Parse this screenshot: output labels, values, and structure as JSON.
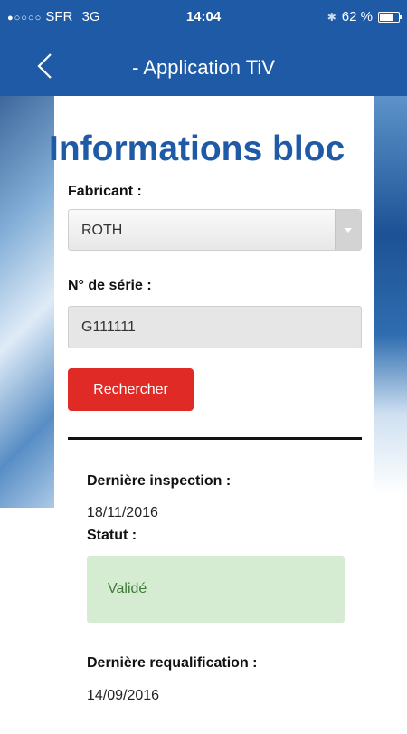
{
  "status_bar": {
    "carrier_signal": "●○○○○",
    "carrier": "SFR",
    "network": "3G",
    "time": "14:04",
    "bluetooth": "✱",
    "battery_text": "62 %",
    "battery_level": 0.62
  },
  "nav": {
    "title": "- Application TiV",
    "back_icon": "chevron-left-icon"
  },
  "form": {
    "heading": "Informations bloc",
    "fabricant_label": "Fabricant :",
    "fabricant_value": "ROTH",
    "serie_label": "N° de série :",
    "serie_value": "G111111",
    "search_button": "Rechercher"
  },
  "results": {
    "last_inspection_label": "Dernière inspection :",
    "last_inspection_value": "18/11/2016",
    "statut_label": "Statut :",
    "statut_value": "Validé",
    "last_requalification_label": "Dernière requalification :",
    "last_requalification_value": "14/09/2016"
  },
  "colors": {
    "brand_blue": "#1f5aa6",
    "button_red": "#e02a26",
    "status_green_bg": "#d6ecd2",
    "status_green_text": "#3d7a35"
  }
}
